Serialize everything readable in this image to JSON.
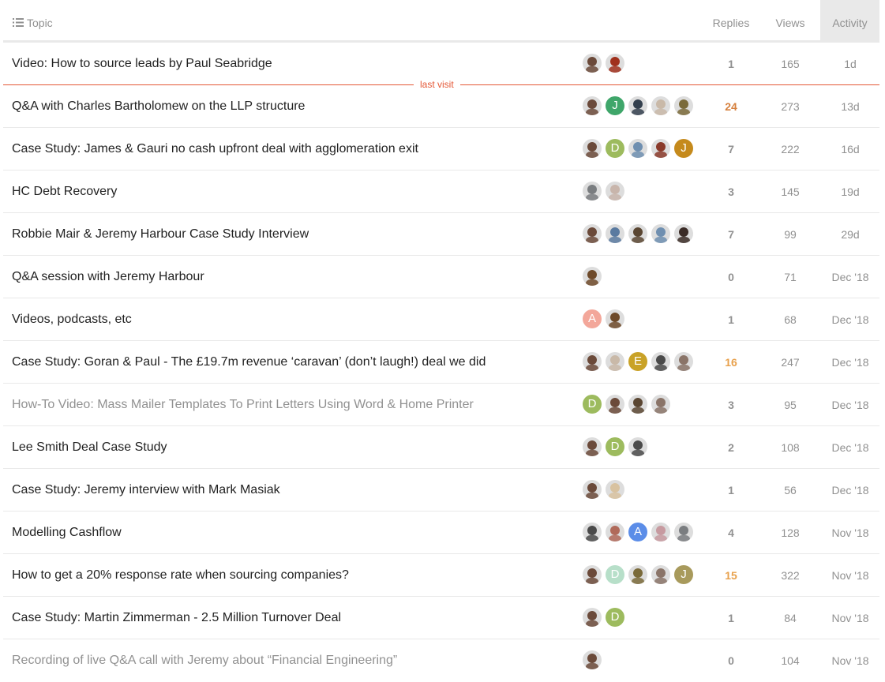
{
  "header": {
    "topic_label": "Topic",
    "replies_label": "Replies",
    "views_label": "Views",
    "activity_label": "Activity"
  },
  "last_visit_label": "last visit",
  "colors": {
    "muted": "#919191",
    "last_visit_line": "#e45735",
    "hot_replies": "#e8a14d",
    "hotter_replies": "#d6813f",
    "activity_header_bg": "#e9e9e9"
  },
  "topics": [
    {
      "title": "Video: How to source leads by Paul Seabridge",
      "visited": false,
      "replies": "1",
      "views": "165",
      "activity": "1d",
      "heat": "",
      "avatars": [
        "photo-bald-man",
        "photo-red-man"
      ]
    },
    {
      "title": "Q&A with Charles Bartholomew on the LLP structure",
      "visited": false,
      "replies": "24",
      "views": "273",
      "activity": "13d",
      "heat": "hotter",
      "avatars": [
        "photo-bald-man",
        "J",
        "photo-suited-man",
        "photo-light-man",
        "photo-group"
      ]
    },
    {
      "title": "Case Study: James & Gauri no cash upfront deal with agglomeration exit",
      "visited": false,
      "replies": "7",
      "views": "222",
      "activity": "16d",
      "heat": "",
      "avatars": [
        "photo-bald-man",
        "D",
        "photo-group-blue",
        "photo-red-group",
        "J"
      ]
    },
    {
      "title": "HC Debt Recovery",
      "visited": false,
      "replies": "3",
      "views": "145",
      "activity": "19d",
      "heat": "",
      "avatars": [
        "photo-grey-man",
        "photo-pale-man"
      ]
    },
    {
      "title": "Robbie Mair & Jeremy Harbour Case Study Interview",
      "visited": false,
      "replies": "7",
      "views": "99",
      "activity": "29d",
      "heat": "",
      "avatars": [
        "photo-bald-man",
        "photo-blue-suit",
        "photo-woman-curly",
        "photo-group-blue",
        "photo-dark-woman"
      ]
    },
    {
      "title": "Q&A session with Jeremy Harbour",
      "visited": false,
      "replies": "0",
      "views": "71",
      "activity": "Dec '18",
      "heat": "",
      "avatars": [
        "photo-brown-group"
      ]
    },
    {
      "title": "Videos, podcasts, etc",
      "visited": false,
      "replies": "1",
      "views": "68",
      "activity": "Dec '18",
      "heat": "",
      "avatars": [
        "A",
        "photo-brown-group"
      ]
    },
    {
      "title": "Case Study: Goran & Paul - The £19.7m revenue ‘caravan’ (don’t laugh!) deal we did",
      "visited": false,
      "replies": "16",
      "views": "247",
      "activity": "Dec '18",
      "heat": "hot",
      "avatars": [
        "photo-bald-man",
        "photo-light-man",
        "E",
        "photo-sunglasses",
        "photo-shaved-man"
      ]
    },
    {
      "title": "How-To Video: Mass Mailer Templates To Print Letters Using Word & Home Printer",
      "visited": true,
      "replies": "3",
      "views": "95",
      "activity": "Dec '18",
      "heat": "",
      "avatars": [
        "D",
        "photo-bald-man",
        "photo-woman-curly",
        "photo-shaved-man"
      ]
    },
    {
      "title": "Lee Smith Deal Case Study",
      "visited": false,
      "replies": "2",
      "views": "108",
      "activity": "Dec '18",
      "heat": "",
      "avatars": [
        "photo-bald-man",
        "D",
        "photo-sunglasses"
      ]
    },
    {
      "title": "Case Study: Jeremy interview with Mark Masiak",
      "visited": false,
      "replies": "1",
      "views": "56",
      "activity": "Dec '18",
      "heat": "",
      "avatars": [
        "photo-bald-man",
        "photo-blonde-woman"
      ]
    },
    {
      "title": "Modelling Cashflow",
      "visited": false,
      "replies": "4",
      "views": "128",
      "activity": "Nov '18",
      "heat": "",
      "avatars": [
        "photo-sunglasses",
        "photo-red-woman",
        "A",
        "photo-pink-man",
        "photo-grey-man"
      ]
    },
    {
      "title": "How to get a 20% response rate when sourcing companies?",
      "visited": false,
      "replies": "15",
      "views": "322",
      "activity": "Nov '18",
      "heat": "hot",
      "avatars": [
        "photo-bald-man",
        "D",
        "photo-group",
        "photo-shaved-man",
        "J"
      ]
    },
    {
      "title": "Case Study: Martin Zimmerman - 2.5 Million Turnover Deal",
      "visited": false,
      "replies": "1",
      "views": "84",
      "activity": "Nov '18",
      "heat": "",
      "avatars": [
        "photo-bald-man",
        "D"
      ]
    },
    {
      "title": "Recording of live Q&A call with Jeremy about “Financial Engineering”",
      "visited": true,
      "replies": "0",
      "views": "104",
      "activity": "Nov '18",
      "heat": "",
      "avatars": [
        "photo-bald-man"
      ]
    }
  ]
}
